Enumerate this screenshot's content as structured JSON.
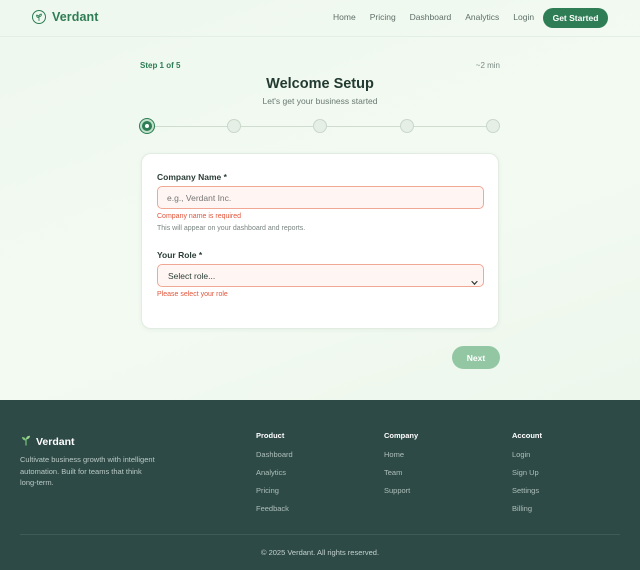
{
  "header": {
    "brand": "Verdant",
    "nav": [
      "Home",
      "Pricing",
      "Dashboard",
      "Analytics",
      "Login"
    ],
    "cta_label": "Get Started"
  },
  "setup": {
    "step_label": "Step 1 of 5",
    "time_estimate": "~2 min",
    "title": "Welcome Setup",
    "subtitle": "Let's get your business started",
    "total_steps": 5,
    "current_step": 1
  },
  "form": {
    "company_name_label": "Company Name *",
    "company_name_placeholder": "e.g., Verdant Inc.",
    "company_name_value": "",
    "company_name_error": "Company name is required",
    "company_name_help": "This will appear on your dashboard and reports.",
    "role_label": "Your Role *",
    "role_selected": "Select role...",
    "role_error": "Please select your role"
  },
  "next_label": "Next",
  "footer": {
    "brand": "Verdant",
    "description": "Cultivate business growth with intelligent automation. Built for teams that think long-term.",
    "columns": [
      {
        "title": "Product",
        "links": [
          "Dashboard",
          "Analytics",
          "Pricing",
          "Feedback"
        ]
      },
      {
        "title": "Company",
        "links": [
          "Home",
          "Team",
          "Support"
        ]
      },
      {
        "title": "Account",
        "links": [
          "Login",
          "Sign Up",
          "Settings",
          "Billing"
        ]
      }
    ],
    "copyright": "© 2025 Verdant. All rights reserved."
  },
  "colors": {
    "brand": "#2e7d55",
    "error": "#e0553b",
    "footer_bg": "#2e4a47",
    "next_disabled": "#93c7a4"
  },
  "icons": {
    "brand_logo": "sprout-circle-icon",
    "footer_logo": "sprout-icon",
    "select_chevron": "chevron-down-icon"
  }
}
